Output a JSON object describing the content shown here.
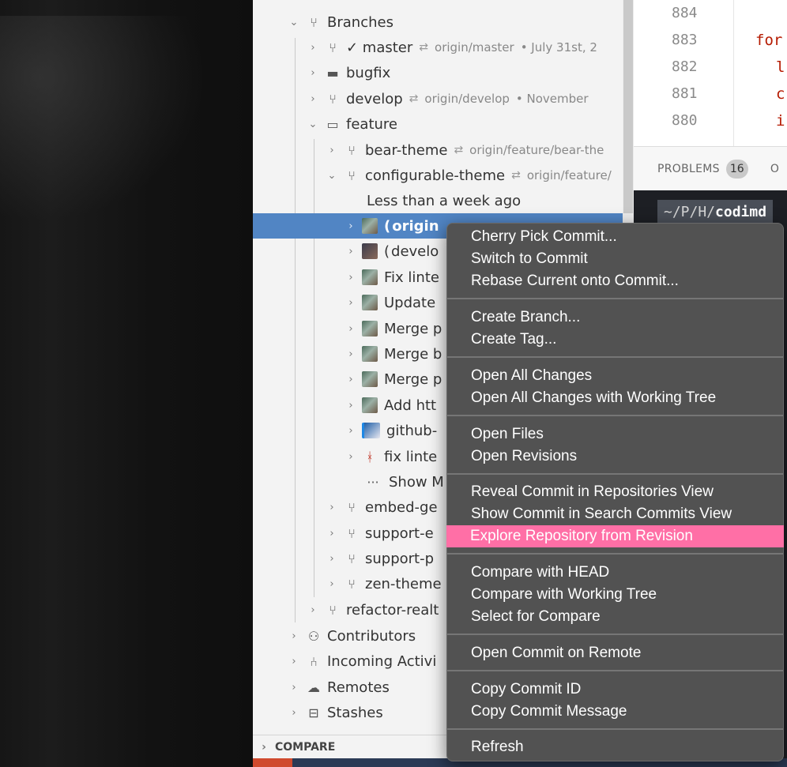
{
  "colors": {
    "selected_row": "#5185c4",
    "menu_bg": "#525252",
    "menu_highlight": "#ff6fa6",
    "code_red": "#b51a00"
  },
  "sidebar": {
    "rows": [
      {
        "label": "Branches",
        "icon": "branch-icon",
        "chevron": "⌄"
      },
      {
        "label": "✓ master",
        "icon": "branch-icon",
        "chevron": "›",
        "remote": "origin/master",
        "desc": "•  July 31st, 2"
      },
      {
        "label": "bugfix",
        "icon": "folder-icon",
        "chevron": "›"
      },
      {
        "label": "develop",
        "icon": "branch-icon",
        "chevron": "›",
        "remote": "origin/develop",
        "desc": "•  November"
      },
      {
        "label": "feature",
        "icon": "folder-icon",
        "chevron": "⌄"
      },
      {
        "label": "bear-theme",
        "icon": "branch-icon",
        "chevron": "›",
        "remote": "origin/feature/bear-the"
      },
      {
        "label": "configurable-theme",
        "icon": "branch-icon",
        "chevron": "⌄",
        "remote": "origin/feature/"
      },
      {
        "label": "Less than a week ago"
      },
      {
        "label": "origin",
        "chevron": "›",
        "prefix": "("
      },
      {
        "label": "develo",
        "chevron": "›",
        "prefix": "("
      },
      {
        "label": "Fix linte",
        "chevron": "›"
      },
      {
        "label": "Update",
        "chevron": "›"
      },
      {
        "label": "Merge p",
        "chevron": "›"
      },
      {
        "label": "Merge b",
        "chevron": "›"
      },
      {
        "label": "Merge p",
        "chevron": "›"
      },
      {
        "label": "Add htt",
        "chevron": "›"
      },
      {
        "label": "github-",
        "chevron": "›"
      },
      {
        "label": "fix linte",
        "chevron": "›"
      },
      {
        "label": "Show M",
        "icon": "more-icon"
      },
      {
        "label": "embed-ge",
        "icon": "branch-icon",
        "chevron": "›"
      },
      {
        "label": "support-e",
        "icon": "branch-icon",
        "chevron": "›"
      },
      {
        "label": "support-p",
        "icon": "branch-icon",
        "chevron": "›"
      },
      {
        "label": "zen-theme",
        "icon": "branch-icon",
        "chevron": "›"
      },
      {
        "label": "refactor-realt",
        "icon": "branch-icon",
        "chevron": "›"
      },
      {
        "label": "Contributors",
        "icon": "contributors-icon",
        "chevron": "›"
      },
      {
        "label": "Incoming Activi",
        "icon": "merge-icon",
        "chevron": "›"
      },
      {
        "label": "Remotes",
        "icon": "cloud-icon",
        "chevron": "›"
      },
      {
        "label": "Stashes",
        "icon": "inbox-icon",
        "chevron": "›"
      }
    ],
    "compare_label": "COMPARE"
  },
  "editor": {
    "line_numbers": [
      "884",
      "883",
      "882",
      "881",
      "880"
    ],
    "code": [
      "for",
      "l",
      "c",
      "i"
    ]
  },
  "panel": {
    "problems_label": "PROBLEMS",
    "problems_count": "16",
    "next_tab": "O"
  },
  "terminal": {
    "prompt_path": "~/P/H/",
    "prompt_dir": "codimd"
  },
  "context_menu": {
    "items": [
      "Cherry Pick Commit...",
      "Switch to Commit",
      "Rebase Current onto Commit...",
      "Create Branch...",
      "Create Tag...",
      "Open All Changes",
      "Open All Changes with Working Tree",
      "Open Files",
      "Open Revisions",
      "Reveal Commit in Repositories View",
      "Show Commit in Search Commits View",
      "Explore Repository from Revision",
      "Compare with HEAD",
      "Compare with Working Tree",
      "Select for Compare",
      "Open Commit on Remote",
      "Copy Commit ID",
      "Copy Commit Message",
      "Refresh"
    ],
    "highlighted": "Explore Repository from Revision"
  }
}
